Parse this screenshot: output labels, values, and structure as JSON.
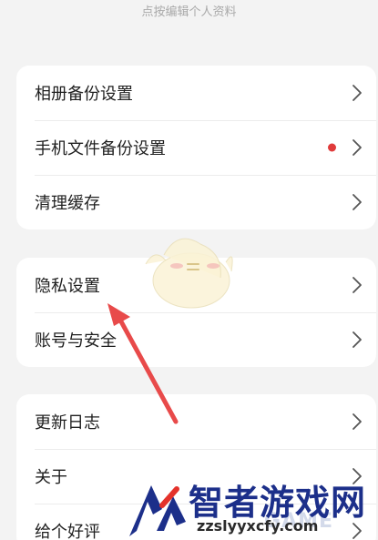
{
  "header": {
    "hint": "点按编辑个人资料"
  },
  "groups": [
    {
      "items": [
        {
          "label": "相册备份设置",
          "badge": false
        },
        {
          "label": "手机文件备份设置",
          "badge": true
        },
        {
          "label": "清理缓存",
          "badge": false
        }
      ]
    },
    {
      "items": [
        {
          "label": "隐私设置",
          "badge": false
        },
        {
          "label": "账号与安全",
          "badge": false
        }
      ]
    },
    {
      "items": [
        {
          "label": "更新日志",
          "badge": false
        },
        {
          "label": "关于",
          "badge": false
        },
        {
          "label": "给个好评",
          "badge": false
        }
      ]
    }
  ],
  "watermark": {
    "title": "智者游戏网",
    "url": "zzslyyxcfy.com",
    "overlay": "GAME"
  },
  "colors": {
    "background": "#f3f3f3",
    "card": "#ffffff",
    "badge": "#e03b3b",
    "arrow": "#e84a4a",
    "chevron": "#555555"
  },
  "icons": {
    "chevron": "chevron-right-icon",
    "badge": "red-dot-badge",
    "mascot": "chick-mascot",
    "annotation": "red-arrow"
  }
}
